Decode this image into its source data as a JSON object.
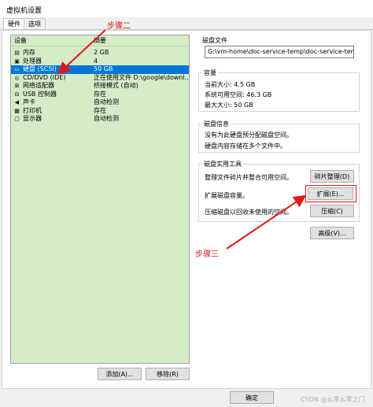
{
  "window": {
    "title": "虚拟机设置"
  },
  "tabs": [
    {
      "label": "硬件"
    },
    {
      "label": "选项"
    }
  ],
  "device_table": {
    "col_device": "设备",
    "col_summary": "摘要",
    "rows": [
      {
        "icon": "memory-icon",
        "glyph": "▤",
        "name": "内存",
        "summary": "2 GB"
      },
      {
        "icon": "cpu-icon",
        "glyph": "▣",
        "name": "处理器",
        "summary": "4"
      },
      {
        "icon": "harddisk-icon",
        "glyph": "▭",
        "name": "硬盘 (SCSI)",
        "summary": "50 GB"
      },
      {
        "icon": "cd-dvd-icon",
        "glyph": "◎",
        "name": "CD/DVD (IDE)",
        "summary": "正在使用文件 D:\\google\\downl..."
      },
      {
        "icon": "network-adapter-icon",
        "glyph": "⊞",
        "name": "网络适配器",
        "summary": "桥接模式 (自动)"
      },
      {
        "icon": "usb-icon",
        "glyph": "⊟",
        "name": "USB 控制器",
        "summary": "存在"
      },
      {
        "icon": "sound-card-icon",
        "glyph": "◀",
        "name": "声卡",
        "summary": "自动检测"
      },
      {
        "icon": "printer-icon",
        "glyph": "▦",
        "name": "打印机",
        "summary": "存在"
      },
      {
        "icon": "display-icon",
        "glyph": "▢",
        "name": "显示器",
        "summary": "自动检测"
      }
    ]
  },
  "bottom_buttons": {
    "add": "添加(A)...",
    "remove": "移除(R)"
  },
  "disk_file": {
    "label": "磁盘文件",
    "value": "G:\\vm-home\\doc-service-temp\\doc-service-temp.vmd"
  },
  "capacity": {
    "label": "容量",
    "current_size": "当前大小: 4.5 GB",
    "system_free": "系统可用空间: 46.3 GB",
    "max_size": "最大大小: 50 GB"
  },
  "disk_info": {
    "label": "磁盘信息",
    "line1": "没有为此硬盘预分配磁盘空间。",
    "line2": "硬盘内容存储在多个文件中。"
  },
  "disk_utilities": {
    "label": "磁盘实用工具",
    "defrag_text": "整理文件碎片并整合可用空间。",
    "defrag_button": "碎片整理(D)",
    "expand_text": "扩展磁盘容量。",
    "expand_button": "扩展(E)...",
    "compact_text": "压缩磁盘以回收未使用的空间。",
    "compact_button": "压缩(C)"
  },
  "advanced_button": "高级(V)...",
  "footer": {
    "ok": "确定",
    "watermark": "CSDN @幺零幺零之门"
  },
  "annotations": {
    "step2": "步骤二",
    "step3": "步骤三",
    "color": "#e0191a"
  }
}
